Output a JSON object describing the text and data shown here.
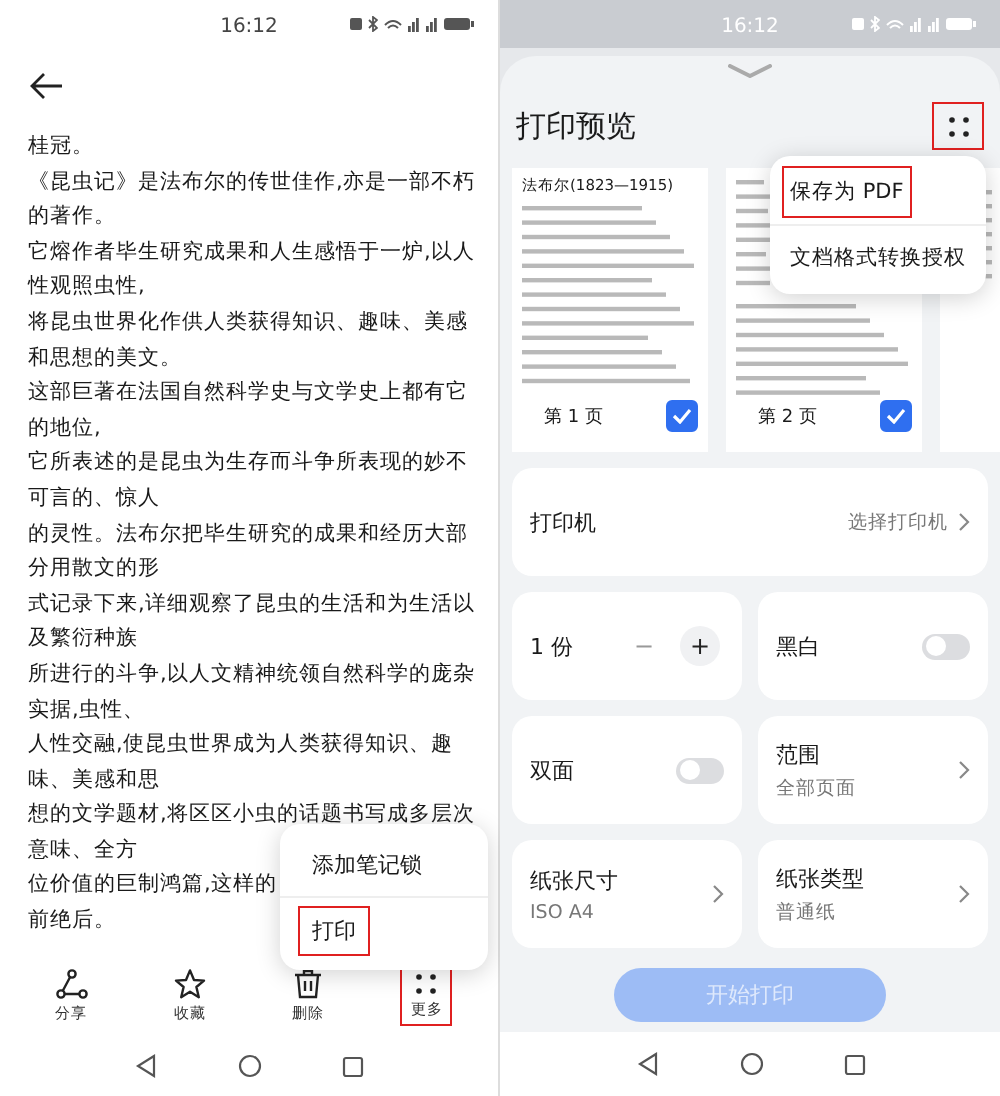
{
  "left": {
    "status_time": "16:12",
    "text_lines": [
      "桂冠。",
      "《昆虫记》是法布尔的传世佳作,亦是一部不朽",
      "的著作。",
      "它熔作者毕生研究成果和人生感悟于一炉,以人",
      "性观照虫性,",
      "将昆虫世界化作供人类获得知识、趣味、美感",
      "和思想的美文。",
      "这部巨著在法国自然科学史与文学史上都有它",
      "的地位,",
      "它所表述的是昆虫为生存而斗争所表现的妙不",
      "可言的、惊人",
      "的灵性。法布尔把毕生研究的成果和经历大部",
      "分用散文的形",
      "式记录下来,详细观察了昆虫的生活和为生活以",
      "及繁衍种族",
      "所进行的斗争,以人文精神统领自然科学的庞杂",
      "实据,虫性、",
      "人性交融,使昆虫世界成为人类获得知识、趣",
      "味、美感和思",
      "想的文学题材,将区区小虫的话题书写成多层次",
      "意味、全方",
      "位价值的巨制鸿篇,这样的",
      "前绝后。"
    ],
    "menu": [
      {
        "label": "添加笔记锁",
        "highlighted": false
      },
      {
        "label": "打印",
        "highlighted": true
      }
    ],
    "toolbar": [
      {
        "kind": "share",
        "label": "分享",
        "highlighted": false
      },
      {
        "kind": "star",
        "label": "收藏",
        "highlighted": false
      },
      {
        "kind": "trash",
        "label": "删除",
        "highlighted": false
      },
      {
        "kind": "more",
        "label": "更多",
        "highlighted": true
      }
    ]
  },
  "right": {
    "status_time": "16:12",
    "title": "打印预览",
    "more_highlighted": true,
    "menu": [
      {
        "label": "保存为 PDF",
        "highlighted": true
      },
      {
        "label": "文档格式转换授权",
        "highlighted": false
      }
    ],
    "pages": [
      {
        "heading": "法布尔(1823—1915)",
        "label": "第 1 页",
        "checked": true
      },
      {
        "label": "第 2 页",
        "checked": true
      }
    ],
    "printer": {
      "label": "打印机",
      "value": "选择打印机"
    },
    "options": [
      {
        "kind": "stepper",
        "label": "1 份",
        "minus": "−",
        "plus": "+"
      },
      {
        "kind": "toggle",
        "label": "双面",
        "on": false
      },
      {
        "kind": "select",
        "label": "纸张尺寸",
        "value": "ISO A4"
      },
      {
        "kind": "toggle",
        "label": "黑白",
        "on": false
      },
      {
        "kind": "select",
        "label": "范围",
        "value": "全部页面"
      },
      {
        "kind": "select",
        "label": "纸张类型",
        "value": "普通纸"
      }
    ],
    "start_button": {
      "label": "开始打印",
      "disabled": true
    }
  }
}
